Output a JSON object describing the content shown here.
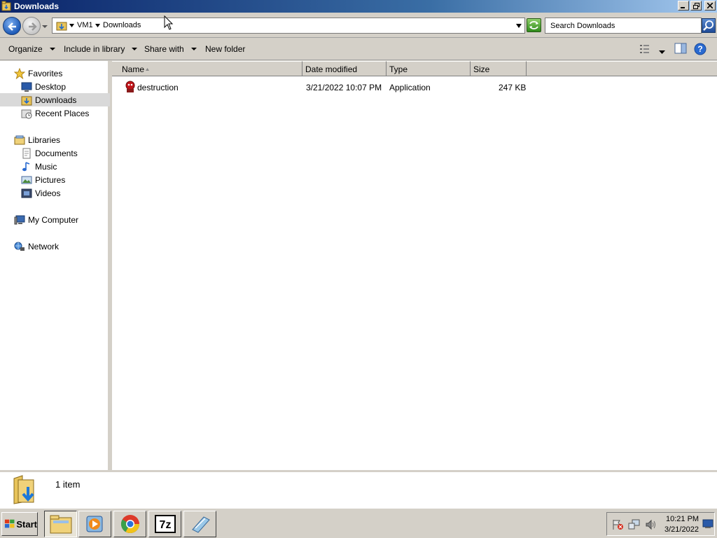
{
  "window": {
    "title": "Downloads"
  },
  "address": {
    "crumbs": [
      "VM1",
      "Downloads"
    ],
    "search_placeholder": "Search Downloads"
  },
  "commands": {
    "organize": "Organize",
    "include": "Include in library",
    "share": "Share with",
    "new_folder": "New folder"
  },
  "nav": {
    "favorites": "Favorites",
    "desktop": "Desktop",
    "downloads": "Downloads",
    "recent": "Recent Places",
    "libraries": "Libraries",
    "documents": "Documents",
    "music": "Music",
    "pictures": "Pictures",
    "videos": "Videos",
    "computer": "My Computer",
    "network": "Network"
  },
  "columns": {
    "name": "Name",
    "date": "Date modified",
    "type": "Type",
    "size": "Size"
  },
  "files": [
    {
      "name": "destruction",
      "date": "3/21/2022 10:07 PM",
      "type": "Application",
      "size": "247 KB"
    }
  ],
  "details": {
    "count": "1 item"
  },
  "taskbar": {
    "start": "Start",
    "time": "10:21 PM",
    "date": "3/21/2022"
  },
  "colors": {
    "title_gradient_start": "#0a246a",
    "title_gradient_end": "#a6caf0",
    "chrome": "#d4d0c8",
    "selected_nav": "#d9d9d9"
  }
}
